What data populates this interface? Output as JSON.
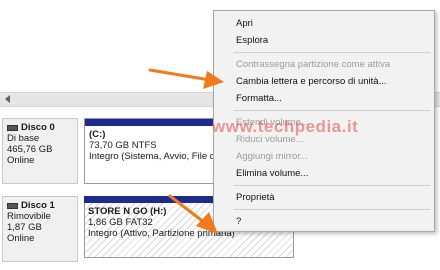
{
  "menu": {
    "items": [
      {
        "label": "Apri",
        "enabled": true
      },
      {
        "label": "Esplora",
        "enabled": true
      },
      {
        "separator": true
      },
      {
        "label": "Contrassegna partizione come attiva",
        "enabled": false
      },
      {
        "label": "Cambia lettera e percorso di unità...",
        "enabled": true
      },
      {
        "label": "Formatta...",
        "enabled": true
      },
      {
        "separator": true
      },
      {
        "label": "Estendi volume...",
        "enabled": false
      },
      {
        "label": "Riduci volume...",
        "enabled": false
      },
      {
        "label": "Aggiungi mirror...",
        "enabled": false
      },
      {
        "label": "Elimina volume...",
        "enabled": true
      },
      {
        "separator": true
      },
      {
        "label": "Proprietà",
        "enabled": true
      },
      {
        "separator": true
      },
      {
        "label": "?",
        "enabled": true
      }
    ]
  },
  "disks": [
    {
      "name": "Disco 0",
      "type": "Di base",
      "size": "465,76 GB",
      "status": "Online",
      "partition": {
        "label": "(C:)",
        "size_fs": "73,70 GB NTFS",
        "status": "Integro (Sistema, Avvio, File di"
      }
    },
    {
      "name": "Disco 1",
      "type": "Rimovibile",
      "size": "1,87 GB",
      "status": "Online",
      "partition": {
        "label": "STORE N GO  (H:)",
        "size_fs": "1,86 GB FAT32",
        "status": "Integro (Attivo, Partizione primaria)"
      }
    }
  ],
  "watermark": "www.techpedia.it",
  "colors": {
    "partition_bar": "#1c2b8f",
    "arrow": "#f07a1c",
    "watermark": "#e74a49"
  }
}
